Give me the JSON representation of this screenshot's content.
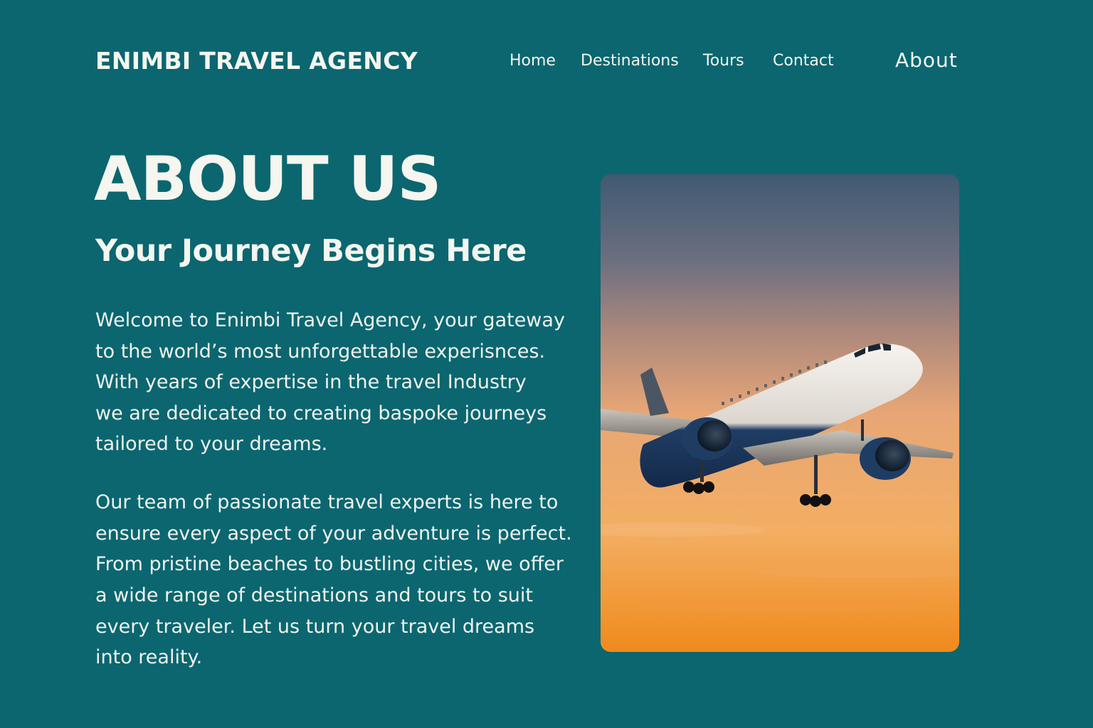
{
  "header": {
    "brand": "ENIMBI TRAVEL AGENCY",
    "nav": {
      "home": "Home",
      "destinations": "Destinations",
      "tours": "Tours",
      "contact": "Contact",
      "about": "About"
    }
  },
  "main": {
    "title": "ABOUT US",
    "subtitle": "Your Journey Begins Here",
    "paragraph1": [
      "Welcome to Enimbi Travel Agency, your gateway",
      "to the world’s most unforgettable experisnces.",
      "With years of expertise in the travel Industry",
      "we are dedicated to creating baspoke journeys",
      "tailored to your dreams."
    ],
    "paragraph2": [
      "Our team of passionate travel experts is here to",
      "ensure every aspect of your adventure is perfect.",
      "From pristine beaches to bustling cities, we offer",
      "a wide range of destinations and tours to suit",
      "every traveler. Let us turn your travel dreams",
      "into reality."
    ]
  },
  "image": {
    "subject": "airplane-sunset-photo"
  },
  "colors": {
    "background": "#0b6670",
    "text": "#f4f6ef",
    "sky_top": "#3f5a72",
    "sky_bottom": "#f08a1c"
  }
}
